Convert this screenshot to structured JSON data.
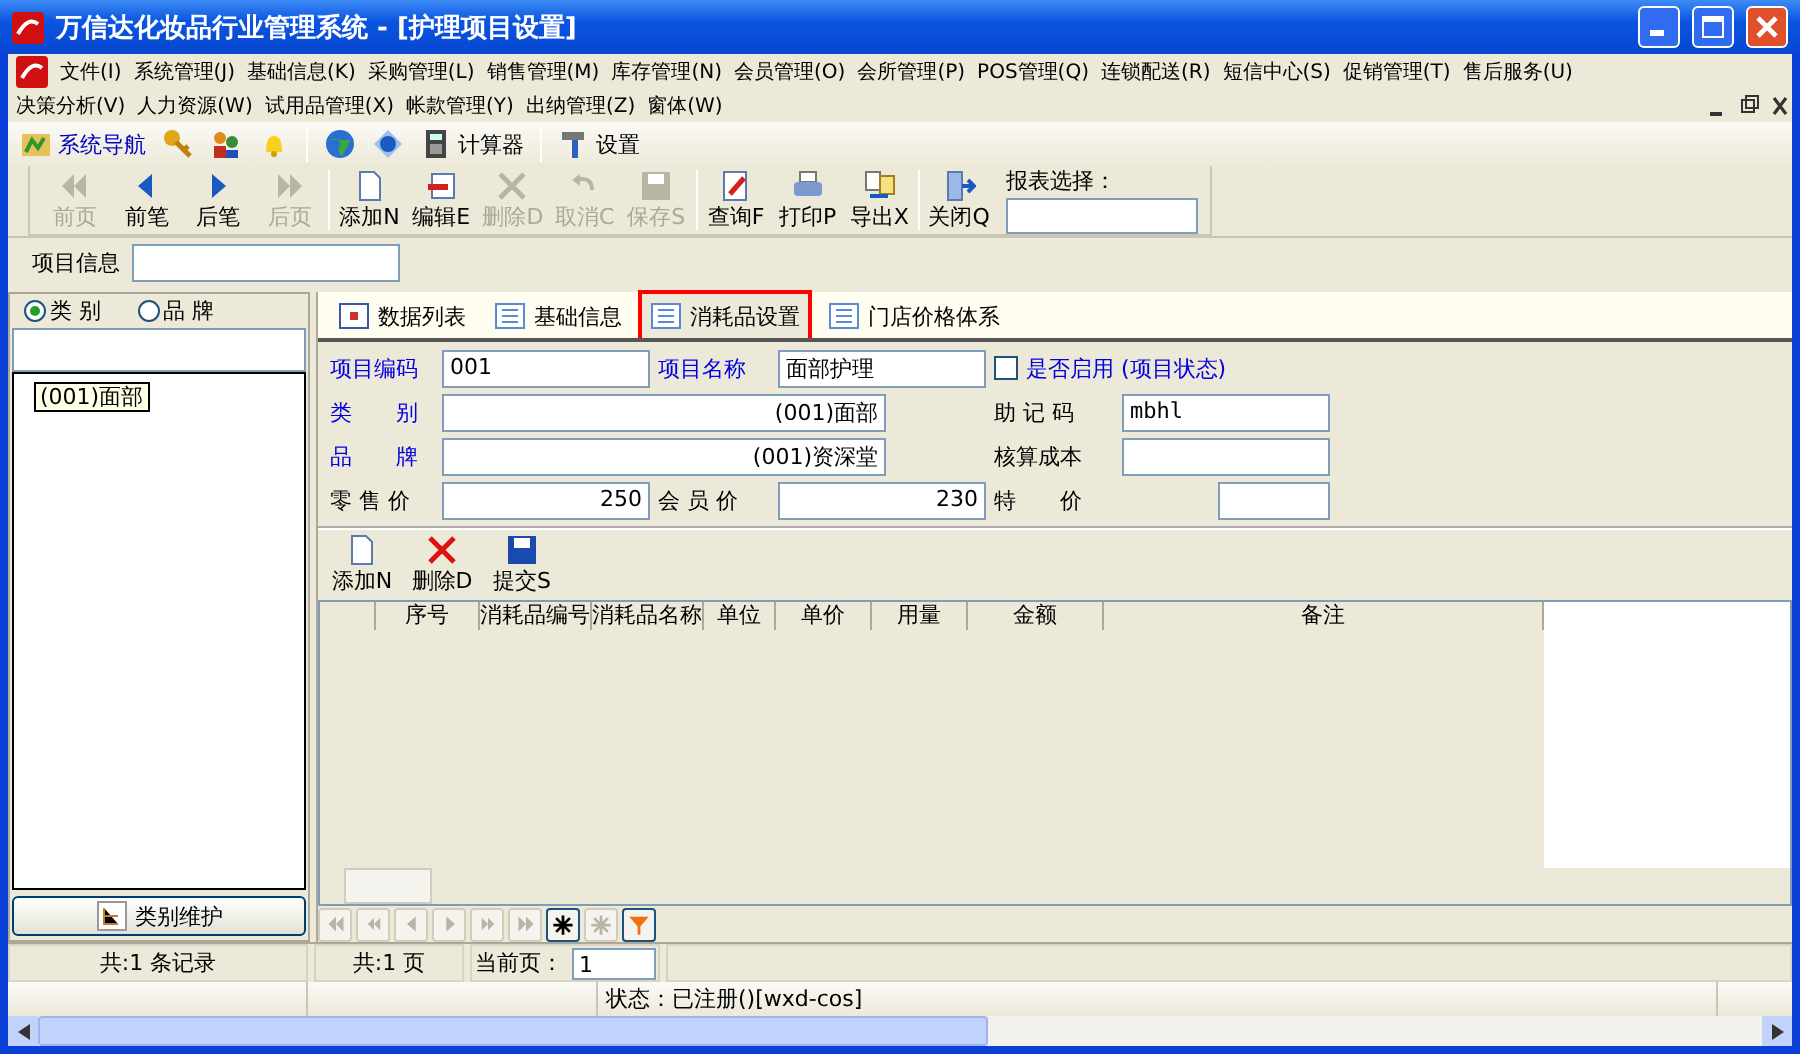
{
  "window": {
    "title": "万信达化妆品行业管理系统 - [护理项目设置]"
  },
  "menu_rows": [
    [
      "文件(I)",
      "系统管理(J)",
      "基础信息(K)",
      "采购管理(L)",
      "销售管理(M)",
      "库存管理(N)",
      "会员管理(O)",
      "会所管理(P)",
      "POS管理(Q)",
      "连锁配送(R)",
      "短信中心(S)",
      "促销管理(T)",
      "售后服务(U)"
    ],
    [
      "决策分析(V)",
      "人力资源(W)",
      "试用品管理(X)",
      "帐款管理(Y)",
      "出纳管理(Z)",
      "窗体(W)"
    ]
  ],
  "quick_toolbar": [
    {
      "kind": "nav",
      "label": "系统导航"
    },
    {
      "kind": "key"
    },
    {
      "kind": "users"
    },
    {
      "kind": "bell"
    },
    {
      "kind": "sep"
    },
    {
      "kind": "globe"
    },
    {
      "kind": "info"
    },
    {
      "kind": "calc",
      "label": "计算器"
    },
    {
      "kind": "sep"
    },
    {
      "kind": "hammer",
      "label": "设置"
    }
  ],
  "toolbar": [
    {
      "kind": "first",
      "label": "前页",
      "disabled": true
    },
    {
      "kind": "prev",
      "label": "前笔",
      "disabled": false
    },
    {
      "kind": "next",
      "label": "后笔",
      "disabled": false
    },
    {
      "kind": "last",
      "label": "后页",
      "disabled": true
    },
    {
      "kind": "sep"
    },
    {
      "kind": "add",
      "label": "添加N",
      "disabled": false
    },
    {
      "kind": "edit",
      "label": "编辑E",
      "disabled": false
    },
    {
      "kind": "delete",
      "label": "删除D",
      "disabled": true
    },
    {
      "kind": "undo",
      "label": "取消C",
      "disabled": true
    },
    {
      "kind": "save",
      "label": "保存S",
      "disabled": true
    },
    {
      "kind": "sep"
    },
    {
      "kind": "query",
      "label": "查询F",
      "disabled": false
    },
    {
      "kind": "print",
      "label": "打印P",
      "disabled": false
    },
    {
      "kind": "export",
      "label": "导出X",
      "disabled": false
    },
    {
      "kind": "sep"
    },
    {
      "kind": "close",
      "label": "关闭Q",
      "disabled": false
    }
  ],
  "report_select": {
    "label": "报表选择："
  },
  "item_info": {
    "label": "项目信息"
  },
  "left_panel": {
    "radios": [
      {
        "label": "类 别",
        "selected": true
      },
      {
        "label": "品 牌",
        "selected": false
      }
    ],
    "tree": [
      {
        "label": "(001)面部",
        "selected": true
      }
    ],
    "button": "类别维护"
  },
  "tabs": [
    {
      "label": "数据列表",
      "selected": false
    },
    {
      "label": "基础信息",
      "selected": false
    },
    {
      "label": "消耗品设置",
      "selected": true
    },
    {
      "label": "门店价格体系",
      "selected": false
    }
  ],
  "form": {
    "code_label": "项目编码",
    "code": "001",
    "name_label": "项目名称",
    "name": "面部护理",
    "enabled": {
      "label": "是否启用 (项目状态)",
      "checked": false
    },
    "category_label": "类　　别",
    "category": "(001)面部",
    "mnemonic_label": "助 记 码",
    "mnemonic": "mbhl",
    "brand_label": "品　　牌",
    "brand": "(001)资深堂",
    "cost_label": "核算成本",
    "retail_label": "零 售 价",
    "retail": "250",
    "member_label": "会 员 价",
    "member": "230",
    "special_label": "特　　价"
  },
  "sub_toolbar": [
    {
      "kind": "add",
      "label": "添加N"
    },
    {
      "kind": "delete",
      "label": "删除D"
    },
    {
      "kind": "save",
      "label": "提交S"
    }
  ],
  "table": {
    "columns": [
      "序号",
      "消耗品编号",
      "消耗品名称",
      "单位",
      "单价",
      "用量",
      "金额",
      "备注"
    ]
  },
  "pager": [
    {
      "kind": "first",
      "disabled": true
    },
    {
      "kind": "prev-page",
      "disabled": true
    },
    {
      "kind": "prev",
      "disabled": true
    },
    {
      "kind": "next",
      "disabled": true
    },
    {
      "kind": "next-page",
      "disabled": true
    },
    {
      "kind": "last",
      "disabled": true
    },
    {
      "kind": "star",
      "disabled": false
    },
    {
      "kind": "star",
      "disabled": true
    },
    {
      "kind": "filter",
      "disabled": false
    }
  ],
  "footer": {
    "records": "共:1 条记录",
    "pages": "共:1 页",
    "current_label": "当前页：",
    "current": "1"
  },
  "status_bar": {
    "status": "状态：已注册()[wxd-cos]"
  }
}
